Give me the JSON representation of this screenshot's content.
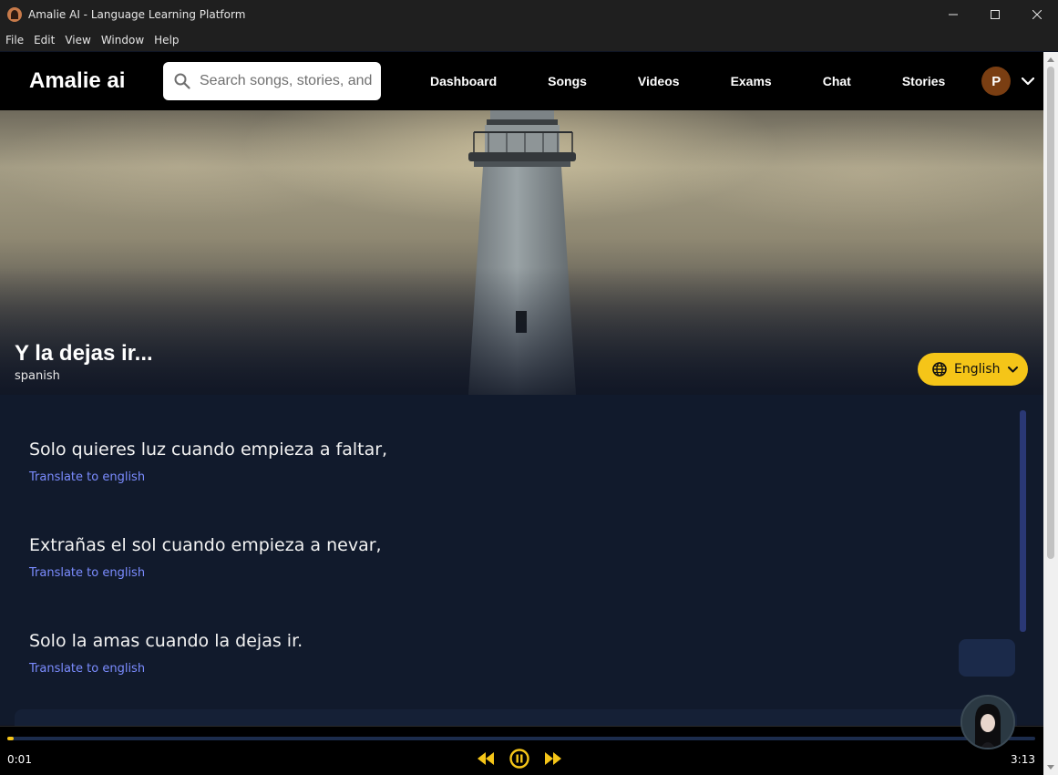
{
  "window": {
    "title": "Amalie AI - Language Learning Platform",
    "icon": "amalie-app-icon",
    "menu": [
      "File",
      "Edit",
      "View",
      "Window",
      "Help"
    ]
  },
  "nav": {
    "brand": "Amalie ai",
    "search_placeholder": "Search songs, stories, and more...",
    "links": [
      "Dashboard",
      "Songs",
      "Videos",
      "Exams",
      "Chat",
      "Stories"
    ],
    "avatar_initial": "P"
  },
  "song": {
    "title": "Y la dejas ir...",
    "language": "spanish",
    "translation_language": "English"
  },
  "lyrics": [
    {
      "text": "Solo quieres luz cuando empieza a faltar,",
      "action": "Translate to english"
    },
    {
      "text": "Extrañas el sol cuando empieza a nevar,",
      "action": "Translate to english"
    },
    {
      "text": "Solo la amas cuando la dejas ir.",
      "action": "Translate to english"
    }
  ],
  "player": {
    "current_time": "0:01",
    "total_time": "3:13",
    "progress": 0.006,
    "state": "playing"
  },
  "colors": {
    "accent": "#f5c518",
    "link": "#7b8cff",
    "background": "#111a2c",
    "nav": "#000000"
  }
}
